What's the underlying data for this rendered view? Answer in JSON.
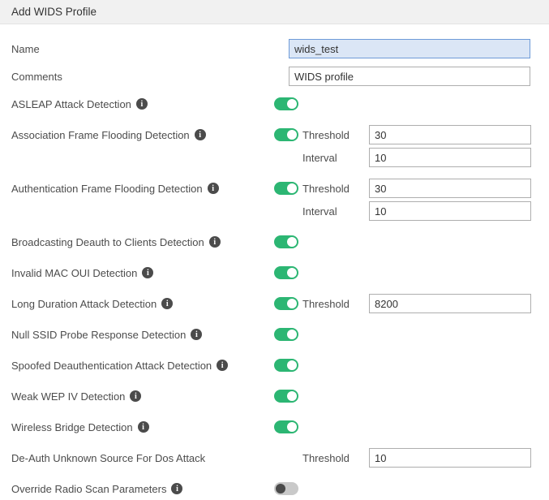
{
  "header": {
    "title": "Add WIDS Profile"
  },
  "icons": {
    "info_glyph": "i"
  },
  "colors": {
    "toggle_on": "#2cb673",
    "toggle_off_track": "#c9c9c9",
    "toggle_off_knob": "#4a4a4a",
    "focused_input_bg": "#dbe6f6",
    "focused_input_border": "#6e9bd8",
    "header_bg": "#f1f1f1"
  },
  "fields": {
    "name": {
      "label": "Name",
      "value": "wids_test"
    },
    "comments": {
      "label": "Comments",
      "value": "WIDS profile"
    }
  },
  "rows": [
    {
      "label": "ASLEAP Attack Detection",
      "toggle": "on"
    },
    {
      "label": "Association Frame Flooding Detection",
      "toggle": "on",
      "fields": [
        {
          "label": "Threshold",
          "value": "30"
        },
        {
          "label": "Interval",
          "value": "10"
        }
      ]
    },
    {
      "label": "Authentication Frame Flooding Detection",
      "toggle": "on",
      "fields": [
        {
          "label": "Threshold",
          "value": "30"
        },
        {
          "label": "Interval",
          "value": "10"
        }
      ]
    },
    {
      "label": "Broadcasting Deauth to Clients Detection",
      "toggle": "on"
    },
    {
      "label": "Invalid MAC OUI Detection",
      "toggle": "on"
    },
    {
      "label": "Long Duration Attack Detection",
      "toggle": "on",
      "fields": [
        {
          "label": "Threshold",
          "value": "8200"
        }
      ]
    },
    {
      "label": "Null SSID Probe Response Detection",
      "toggle": "on"
    },
    {
      "label": "Spoofed Deauthentication Attack Detection",
      "toggle": "on"
    },
    {
      "label": "Weak WEP IV Detection",
      "toggle": "on"
    },
    {
      "label": "Wireless Bridge Detection",
      "toggle": "on"
    },
    {
      "label": "De-Auth Unknown Source For Dos Attack",
      "toggle": "none",
      "fields": [
        {
          "label": "Threshold",
          "value": "10"
        }
      ]
    },
    {
      "label": "Override Radio Scan Parameters",
      "toggle": "off"
    }
  ]
}
